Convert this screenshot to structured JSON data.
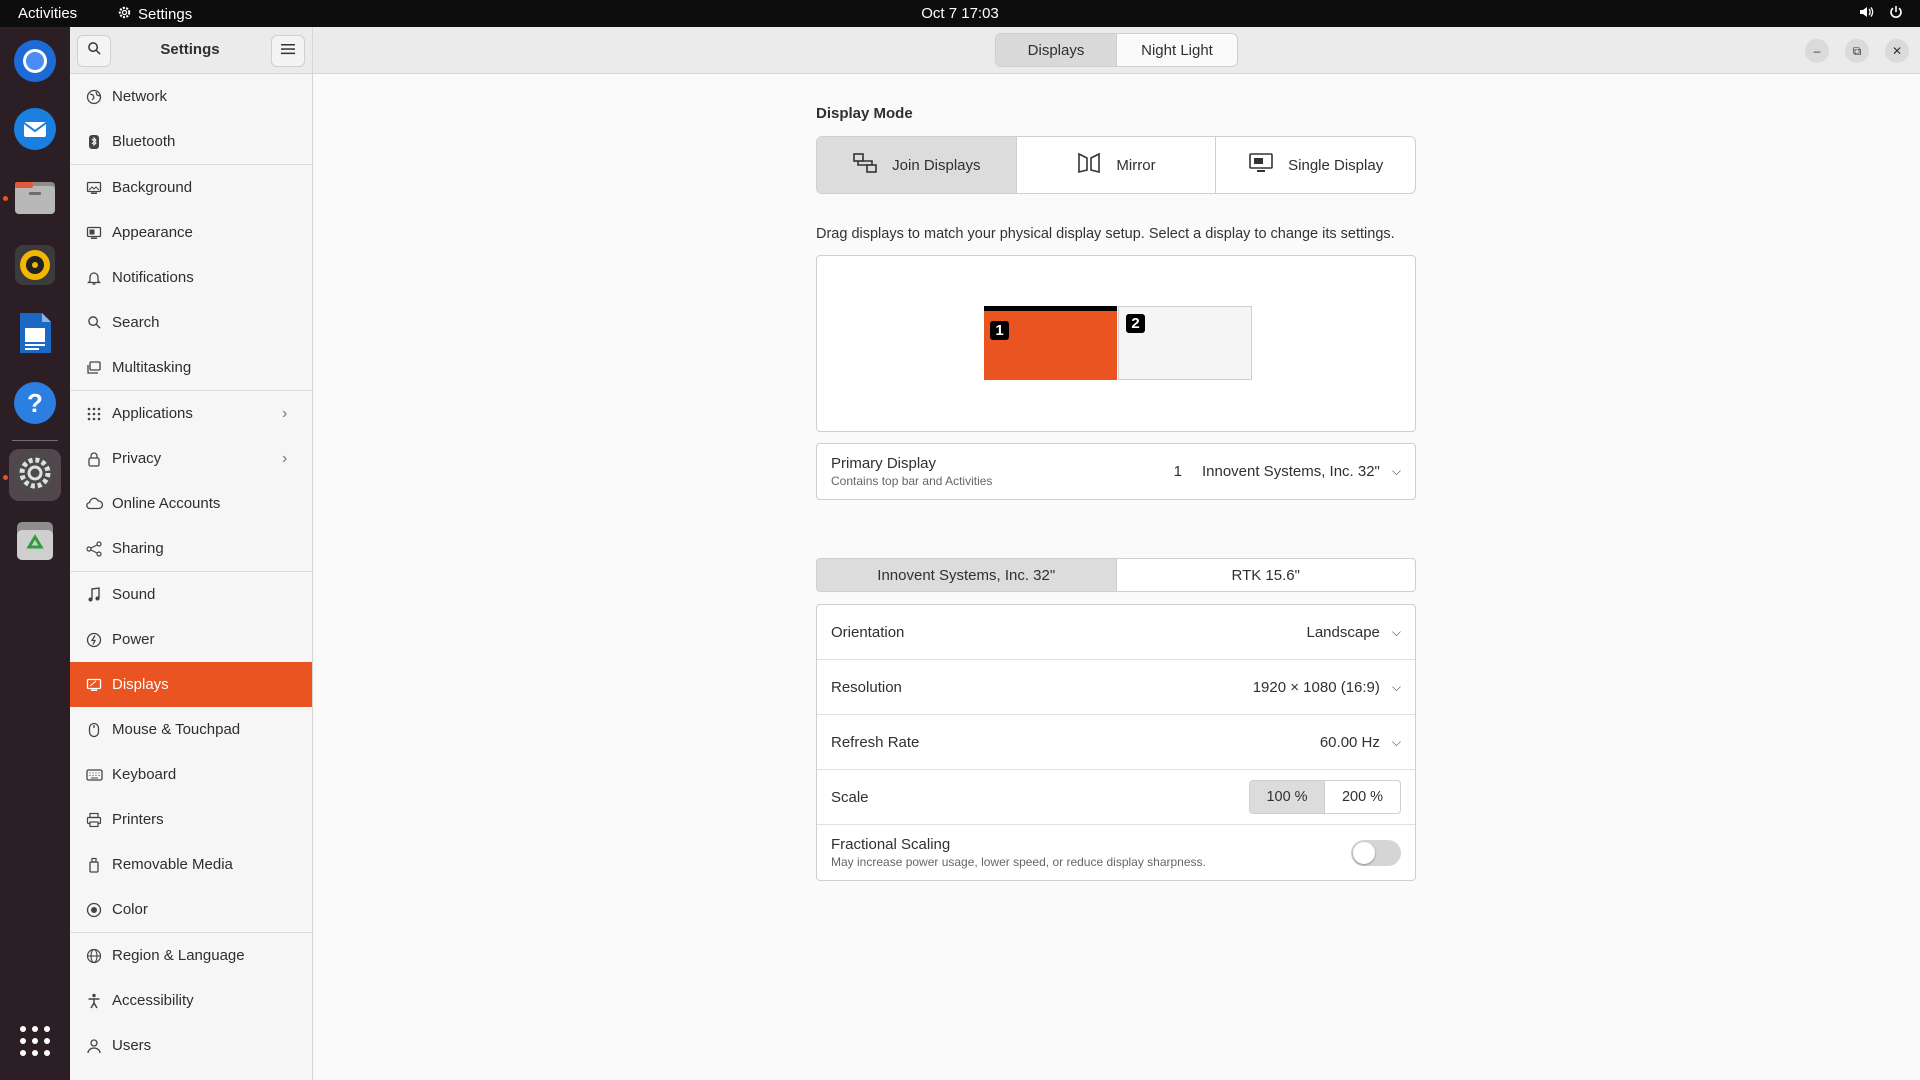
{
  "topbar": {
    "activities": "Activities",
    "app_name": "Settings",
    "clock": "Oct 7  17:03"
  },
  "dock": {
    "items": [
      {
        "icon": "chromium-icon"
      },
      {
        "icon": "thunderbird-icon"
      },
      {
        "icon": "files-icon"
      },
      {
        "icon": "rhythmbox-icon"
      },
      {
        "icon": "writer-icon"
      },
      {
        "icon": "help-icon",
        "label": "?"
      },
      {
        "icon": "settings-icon"
      },
      {
        "icon": "trash-icon"
      },
      {
        "icon": "app-grid-icon"
      }
    ]
  },
  "header": {
    "sidebar_title": "Settings",
    "tabs": [
      {
        "label": "Displays",
        "active": true
      },
      {
        "label": "Night Light",
        "active": false
      }
    ]
  },
  "sidebar": {
    "items": [
      {
        "label": "Network",
        "icon": "network-icon"
      },
      {
        "label": "Bluetooth",
        "icon": "bluetooth-icon"
      },
      {
        "label": "Background",
        "icon": "background-icon"
      },
      {
        "label": "Appearance",
        "icon": "appearance-icon"
      },
      {
        "label": "Notifications",
        "icon": "bell-icon"
      },
      {
        "label": "Search",
        "icon": "search-icon"
      },
      {
        "label": "Multitasking",
        "icon": "multitasking-icon"
      },
      {
        "label": "Applications",
        "icon": "apps-icon"
      },
      {
        "label": "Privacy",
        "icon": "lock-icon"
      },
      {
        "label": "Online Accounts",
        "icon": "cloud-icon"
      },
      {
        "label": "Sharing",
        "icon": "share-icon"
      },
      {
        "label": "Sound",
        "icon": "music-note-icon"
      },
      {
        "label": "Power",
        "icon": "power-icon"
      },
      {
        "label": "Displays",
        "icon": "display-icon"
      },
      {
        "label": "Mouse & Touchpad",
        "icon": "mouse-icon"
      },
      {
        "label": "Keyboard",
        "icon": "keyboard-icon"
      },
      {
        "label": "Printers",
        "icon": "printer-icon"
      },
      {
        "label": "Removable Media",
        "icon": "removable-media-icon"
      },
      {
        "label": "Color",
        "icon": "color-icon"
      },
      {
        "label": "Region & Language",
        "icon": "globe-icon"
      },
      {
        "label": "Accessibility",
        "icon": "accessibility-icon"
      },
      {
        "label": "Users",
        "icon": "user-icon"
      }
    ]
  },
  "display_mode": {
    "heading": "Display Mode",
    "options": [
      {
        "label": "Join Displays",
        "icon": "join-displays-icon",
        "active": true
      },
      {
        "label": "Mirror",
        "icon": "mirror-icon",
        "active": false
      },
      {
        "label": "Single Display",
        "icon": "single-display-icon",
        "active": false
      }
    ]
  },
  "arrangement": {
    "hint": "Drag displays to match your physical display setup. Select a display to change its settings.",
    "monitors": [
      {
        "number": "1",
        "color": "#e95420"
      },
      {
        "number": "2",
        "color": "#f5f5f5"
      }
    ]
  },
  "primary_display": {
    "title": "Primary Display",
    "subtitle": "Contains top bar and Activities",
    "number": "1",
    "value": "Innovent Systems, Inc. 32\""
  },
  "display_tabs": [
    {
      "label": "Innovent Systems, Inc. 32\"",
      "active": true
    },
    {
      "label": "RTK 15.6\"",
      "active": false
    }
  ],
  "settings": {
    "orientation": {
      "label": "Orientation",
      "value": "Landscape"
    },
    "resolution": {
      "label": "Resolution",
      "value": "1920 × 1080 (16:9)"
    },
    "refresh_rate": {
      "label": "Refresh Rate",
      "value": "60.00 Hz"
    },
    "scale": {
      "label": "Scale",
      "options": [
        "100 %",
        "200 %"
      ],
      "selected": "100 %"
    },
    "fractional_scaling": {
      "label": "Fractional Scaling",
      "subtitle": "May increase power usage, lower speed, or reduce display sharpness.",
      "enabled": false
    }
  },
  "colors": {
    "accent": "#e95420",
    "dock": "#2b1e25",
    "topbar": "#0d0d0d"
  }
}
